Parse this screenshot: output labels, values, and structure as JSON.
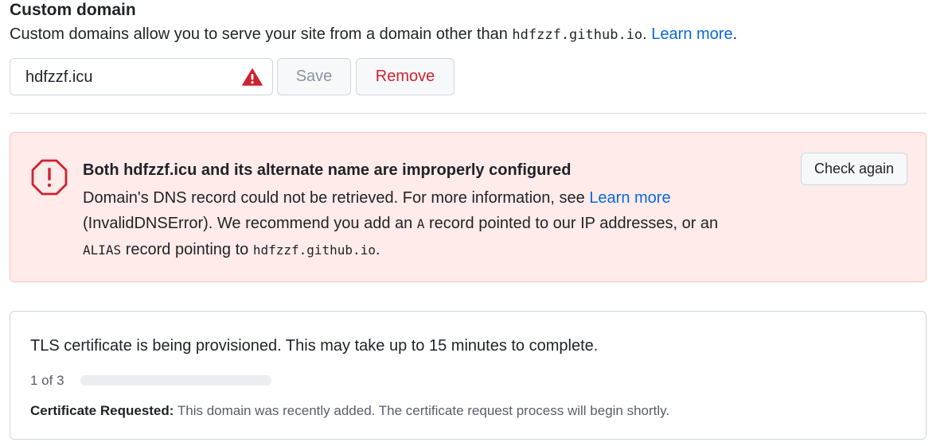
{
  "custom_domain": {
    "heading": "Custom domain",
    "description_prefix": "Custom domains allow you to serve your site from a domain other than ",
    "default_domain": "hdfzzf.github.io",
    "description_suffix": ". ",
    "learn_more": "Learn more",
    "period": ".",
    "input_value": "hdfzzf.icu",
    "save_label": "Save",
    "remove_label": "Remove"
  },
  "dns_error": {
    "title": "Both hdfzzf.icu and its alternate name are improperly configured",
    "line1": "Domain's DNS record could not be retrieved. For more information, see ",
    "learn_more": "Learn more",
    "line2": "(InvalidDNSError). We recommend you add an ",
    "record_a": "A",
    "line3": " record pointed to our IP addresses, or an ",
    "record_alias": "ALIAS",
    "line4": " record pointing to ",
    "target": "hdfzzf.github.io",
    "period": ".",
    "check_again_label": "Check again"
  },
  "tls": {
    "message": "TLS certificate is being provisioned. This may take up to 15 minutes to complete.",
    "step": "1 of 3",
    "progress_fraction": 0,
    "detail_label": "Certificate Requested:",
    "detail_text": " This domain was recently added. The certificate request process will begin shortly."
  },
  "colors": {
    "link": "#0969da",
    "danger": "#cf222e",
    "error_bg": "#ffebe9"
  }
}
